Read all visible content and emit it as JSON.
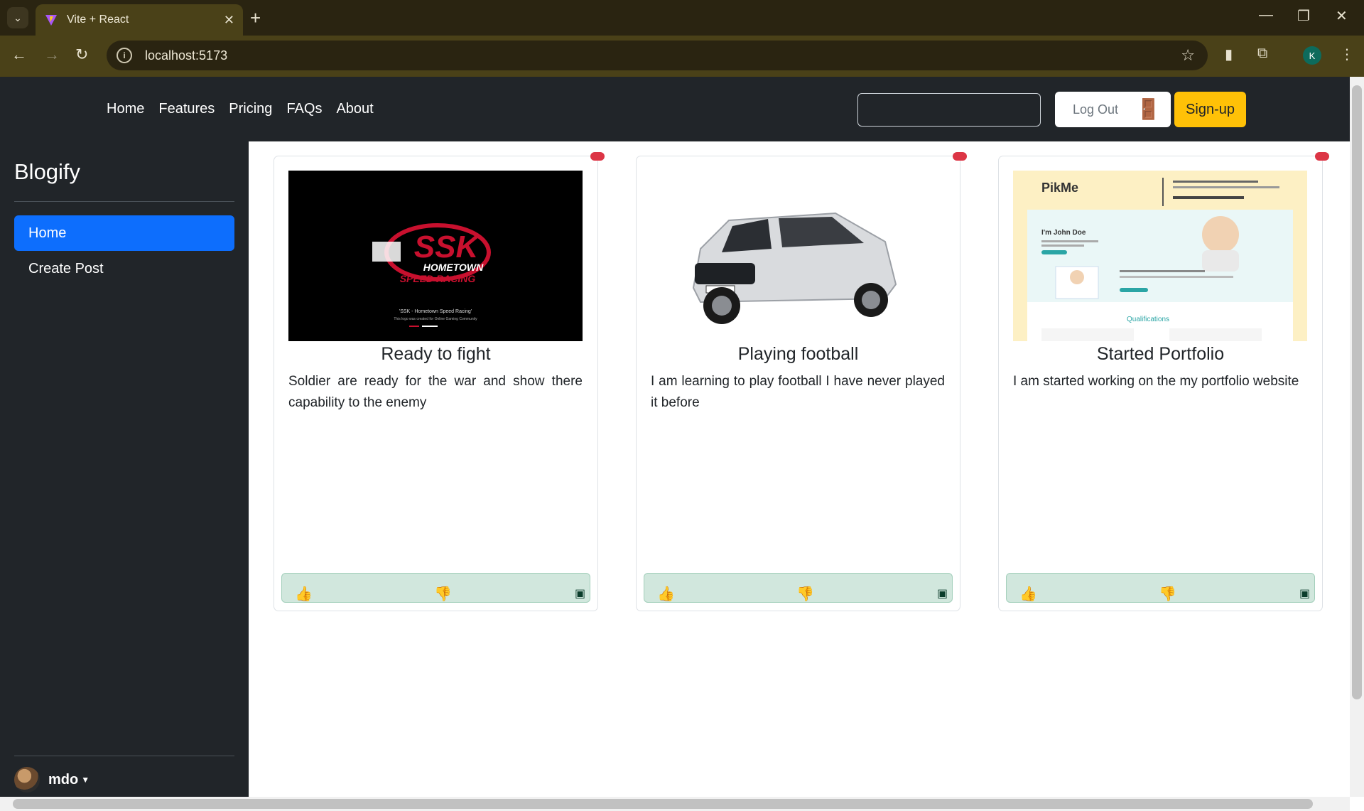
{
  "browser": {
    "tab_title": "Vite + React",
    "url": "localhost:5173",
    "profile_initial": "K"
  },
  "nav": {
    "links": [
      "Home",
      "Features",
      "Pricing",
      "FAQs",
      "About"
    ],
    "search_value": "",
    "logout_label": "Log Out",
    "signup_label": "Sign-up"
  },
  "sidebar": {
    "brand": "Blogify",
    "items": [
      {
        "label": "Home",
        "active": true
      },
      {
        "label": "Create Post",
        "active": false
      }
    ],
    "user": "mdo"
  },
  "posts": [
    {
      "title": "Ready to fight",
      "body": "Soldier are ready for the war and show there capability to the enemy",
      "image": "ssk-logo",
      "image_caption": "'SSK - Hometown Speed Racing'",
      "image_subcaption": "This logo was created for Online Gaming Community"
    },
    {
      "title": "Playing football",
      "body": "I am learning to play football I have never played it before",
      "image": "silver-suv"
    },
    {
      "title": "Started Portfolio",
      "body": "I am started working on the my portfolio website",
      "image": "portfolio-template",
      "image_heading": "PikMe",
      "image_hero": "I'm John Doe",
      "image_section": "Qualifications"
    }
  ],
  "colors": {
    "nav_bg": "#212529",
    "active": "#0d6efd",
    "signup": "#ffc107",
    "actions_bg": "#d1e7dd",
    "badge": "#dc3545"
  }
}
